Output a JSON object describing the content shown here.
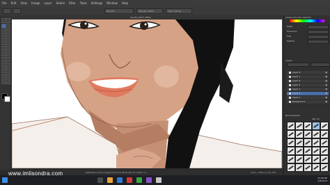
{
  "app": {
    "menu": [
      "File",
      "Edit",
      "View",
      "Image",
      "Layer",
      "Select",
      "Filter",
      "Tools",
      "Settings",
      "Window",
      "Help"
    ],
    "tool_options": {
      "brush_preset": "Brush preset",
      "blend_mode": "Normal",
      "opacity": "Opacity: 100%",
      "size": "Size: 4.00 px"
    },
    "document_tab": "Sondra (3271 3561)"
  },
  "status": {
    "left": "RGB/Alpha (8-bit integer/channel) sRGB-elle-V2-srgbtrc.icc",
    "right": "3271 x 3561 (1.1G)  53%"
  },
  "dock": {
    "brush_docker_title": "Advanced Color Selector",
    "tool_settings": [
      "Mode",
      "Tolerance",
      "Size",
      "Feather"
    ],
    "layers_title": "Layers",
    "layer_blend": "Normal",
    "layer_opacity": "100%",
    "layers": [
      {
        "name": "Layer 8",
        "selected": false
      },
      {
        "name": "Layer 7",
        "selected": false
      },
      {
        "name": "Layer 6",
        "selected": false
      },
      {
        "name": "Layer 5",
        "selected": false
      },
      {
        "name": "Layer 4",
        "selected": false
      },
      {
        "name": "Layer 3",
        "selected": true
      },
      {
        "name": "Layer 2",
        "selected": false
      },
      {
        "name": "Background",
        "selected": false
      }
    ],
    "brush_presets_title": "Brush Presets",
    "brush_tag": "Tag: All"
  },
  "taskbar": {
    "time": "10:08 PM",
    "date": "2/8/2019"
  },
  "watermark": "www.jmlisondra.com"
}
